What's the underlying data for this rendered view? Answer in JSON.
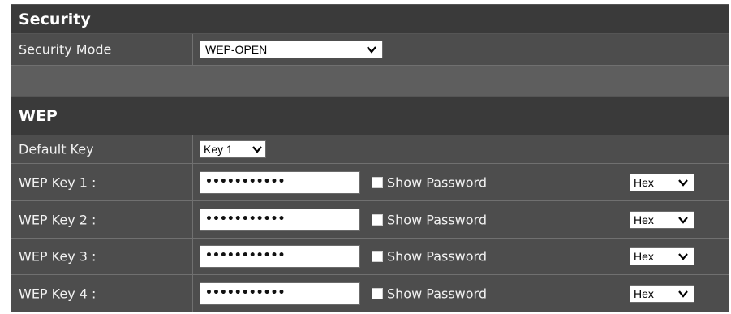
{
  "security": {
    "title": "Security",
    "mode_label": "Security Mode",
    "mode_value": "WEP-OPEN"
  },
  "wep": {
    "title": "WEP",
    "default_key_label": "Default Key",
    "default_key_value": "Key 1",
    "keys": [
      {
        "label": "WEP Key 1 :",
        "value": "•••••••••••",
        "show_password": "Show Password",
        "format": "Hex"
      },
      {
        "label": "WEP Key 2 :",
        "value": "•••••••••••",
        "show_password": "Show Password",
        "format": "Hex"
      },
      {
        "label": "WEP Key 3 :",
        "value": "•••••••••••",
        "show_password": "Show Password",
        "format": "Hex"
      },
      {
        "label": "WEP Key 4 :",
        "value": "•••••••••••",
        "show_password": "Show Password",
        "format": "Hex"
      }
    ]
  },
  "icons": {
    "dropdown": "chevron-down-icon",
    "checkbox": "checkbox-icon"
  },
  "colors": {
    "header_bg": "#3a3a3a",
    "row_bg": "#4d4d4d",
    "spacer_bg": "#5e5e5e",
    "text": "#f2f2f2"
  }
}
